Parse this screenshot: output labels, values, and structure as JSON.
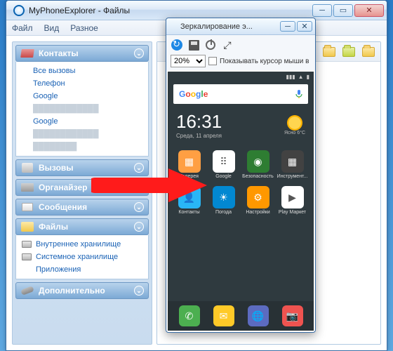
{
  "main_window": {
    "title": "MyPhoneExplorer -  Файлы"
  },
  "menu": {
    "file": "Файл",
    "view": "Вид",
    "misc": "Разное"
  },
  "sidebar": {
    "contacts": {
      "label": "Контакты",
      "items": [
        "Все вызовы",
        "Телефон",
        "Google",
        "",
        "Google",
        "",
        ""
      ]
    },
    "calls": {
      "label": "Вызовы"
    },
    "organizer": {
      "label": "Органайзер"
    },
    "messages": {
      "label": "Сообщения"
    },
    "files": {
      "label": "Файлы",
      "internal": "Внутреннее хранилище",
      "system": "Системное хранилище",
      "apps": "Приложения"
    },
    "extra": {
      "label": "Дополнительно"
    }
  },
  "mirror_window": {
    "title": "Зеркалирование э...",
    "zoom": "20%",
    "cursor_label": "Показывать курсор мыши в"
  },
  "phone": {
    "search_logo": "Google",
    "time": "16:31",
    "date": "Среда, 11 апреля",
    "weather_temp": "6°C",
    "weather_cond": "Ясно",
    "apps_row1": [
      {
        "label": "Галерея",
        "bg": "#ff9f43",
        "glyph": "▦"
      },
      {
        "label": "Google",
        "bg": "#fff",
        "glyph": "⠿"
      },
      {
        "label": "Безопасность",
        "bg": "#2e7d32",
        "glyph": "◉"
      },
      {
        "label": "Инструмент...",
        "bg": "#424242",
        "glyph": "▦"
      }
    ],
    "apps_row2": [
      {
        "label": "Контакты",
        "bg": "#29b6f6",
        "glyph": "👤"
      },
      {
        "label": "Погода",
        "bg": "#0288d1",
        "glyph": "☀"
      },
      {
        "label": "Настройки",
        "bg": "#ff9800",
        "glyph": "⚙"
      },
      {
        "label": "Play Маркет",
        "bg": "#fff",
        "glyph": "▶"
      }
    ],
    "dock": [
      {
        "bg": "#4caf50",
        "glyph": "✆"
      },
      {
        "bg": "#ffca28",
        "glyph": "✉"
      },
      {
        "bg": "#5c6bc0",
        "glyph": "🌐"
      },
      {
        "bg": "#ef5350",
        "glyph": "📷"
      }
    ]
  }
}
